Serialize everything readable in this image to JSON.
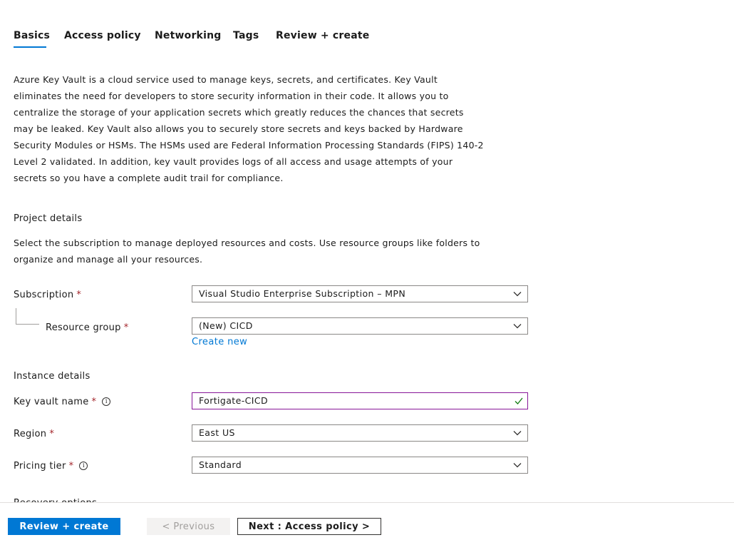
{
  "tabs": [
    {
      "label": "Basics",
      "active": true
    },
    {
      "label": "Access policy"
    },
    {
      "label": "Networking"
    },
    {
      "label": "Tags"
    },
    {
      "label": "Review + create"
    }
  ],
  "description": "Azure Key Vault is a cloud service used to manage keys, secrets, and certificates. Key Vault\neliminates the need for developers to store security information in their code. It allows you to\ncentralize the storage of your application secrets which greatly reduces the chances that secrets\nmay be leaked. Key Vault also allows you to securely store secrets and keys backed by Hardware\nSecurity Modules or HSMs. The HSMs used are Federal Information Processing Standards (FIPS) 140-2\nLevel 2 validated. In addition, key vault provides logs of all access and usage attempts of your\nsecrets so you have a complete audit trail for compliance.",
  "project": {
    "title": "Project details",
    "description": "Select the subscription to manage deployed resources and costs. Use resource groups like folders to\norganize and manage all your resources.",
    "subscription": {
      "label": "Subscription",
      "required": "*",
      "value": "Visual Studio Enterprise Subscription – MPN"
    },
    "resource_group": {
      "label": "Resource group",
      "required": "*",
      "value": "(New) CICD",
      "create_new": "Create new"
    }
  },
  "instance": {
    "title": "Instance details",
    "key_vault_name": {
      "label": "Key vault name",
      "required": "*",
      "value": "Fortigate-CICD",
      "info": "i"
    },
    "region": {
      "label": "Region",
      "required": "*",
      "value": "East US"
    },
    "pricing_tier": {
      "label": "Pricing tier",
      "required": "*",
      "value": "Standard",
      "info": "i"
    }
  },
  "cutoff_section": "Recovery options",
  "footer": {
    "review_create": "Review + create",
    "previous": "< Previous",
    "next": "Next : Access policy >"
  },
  "colors": {
    "accent": "#0078d4",
    "required": "#a4262c",
    "valid_border": "#881798",
    "check": "#107c10"
  },
  "icons": {
    "dropdown": "chevron-down-icon",
    "info": "info-icon",
    "valid": "checkmark-icon"
  }
}
